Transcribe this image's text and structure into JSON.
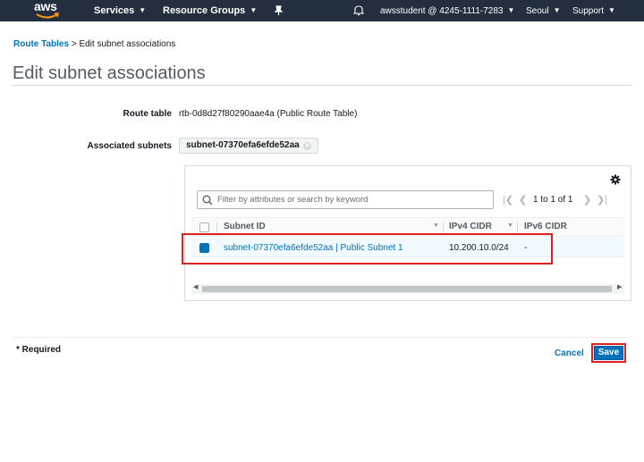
{
  "nav": {
    "logo": "aws",
    "services": "Services",
    "resource_groups": "Resource Groups",
    "account": "awsstudent @ 4245-1111-7283",
    "region": "Seoul",
    "support": "Support"
  },
  "breadcrumb": {
    "parent": "Route Tables",
    "separator": ">",
    "current": "Edit subnet associations"
  },
  "page_title": "Edit subnet associations",
  "route_table": {
    "label": "Route table",
    "value": "rtb-0d8d27f80290aae4a (Public Route Table)"
  },
  "associated": {
    "label": "Associated subnets",
    "token": "subnet-07370efa6efde52aa"
  },
  "table": {
    "search_placeholder": "Filter by attributes or search by keyword",
    "pagination": "1 to 1 of 1",
    "columns": [
      "Subnet ID",
      "IPv4 CIDR",
      "IPv6 CIDR"
    ],
    "rows": [
      {
        "subnet": "subnet-07370efa6efde52aa | Public Subnet 1",
        "ipv4": "10.200.10.0/24",
        "ipv6": "-",
        "selected": true
      }
    ]
  },
  "footer": {
    "required": "* Required",
    "cancel": "Cancel",
    "save": "Save"
  },
  "colors": {
    "nav_bg": "#232f3e",
    "link": "#0073bb",
    "primary": "#0073bb",
    "highlight": "#e0201f"
  }
}
